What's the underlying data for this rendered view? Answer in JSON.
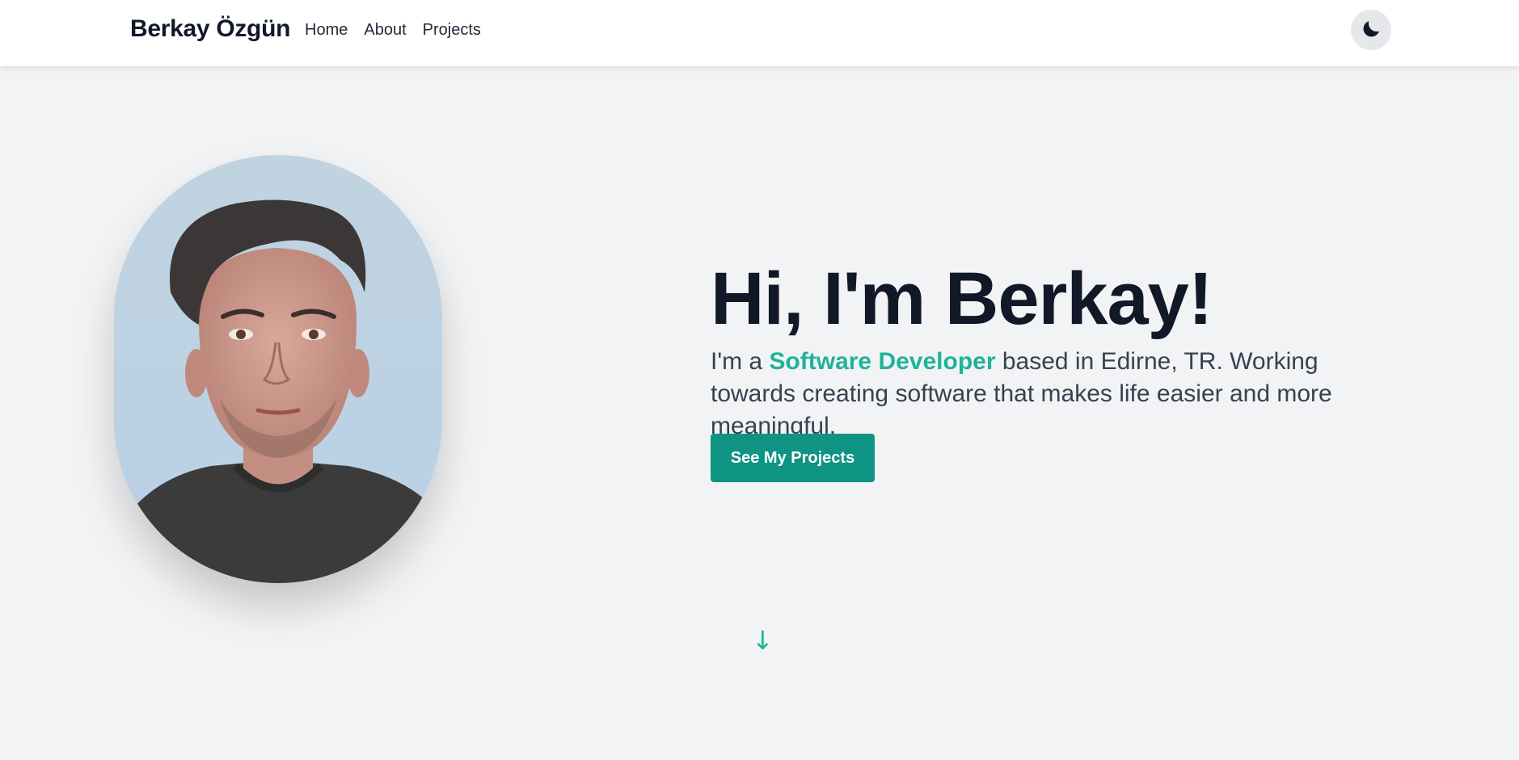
{
  "header": {
    "brand": "Berkay Özgün",
    "nav": [
      {
        "label": "Home"
      },
      {
        "label": "About"
      },
      {
        "label": "Projects"
      }
    ],
    "theme_toggle_icon": "moon-icon"
  },
  "hero": {
    "portrait_icon": "profile-photo",
    "title": "Hi, I'm Berkay!",
    "desc_prefix": "I'm a ",
    "desc_highlight": "Software Developer",
    "desc_suffix": " based in Edirne, TR. Working towards creating software that makes life easier and more meaningful.",
    "cta_label": "See My Projects",
    "scroll_glyph": "↓"
  },
  "colors": {
    "accent": "#1fb39a",
    "button": "#0f9484",
    "background": "#f2f3f5",
    "heading": "#111827"
  }
}
